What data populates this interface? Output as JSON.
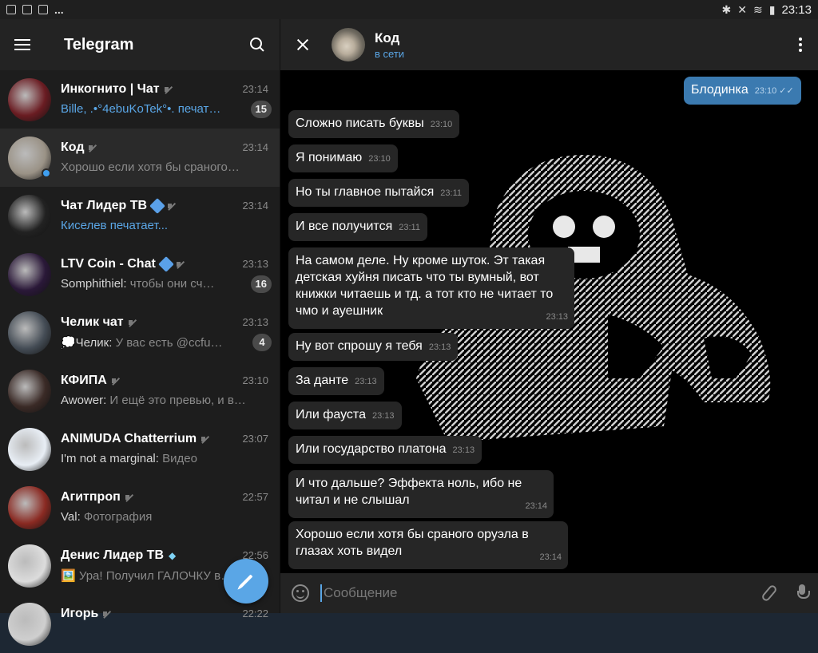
{
  "statusbar": {
    "time": "23:13",
    "dots": "..."
  },
  "sidebar": {
    "app_title": "Telegram",
    "chats": [
      {
        "name": "Инкогнито | Чат",
        "time": "23:14",
        "preview": "Bille, .•°4ebuKoTek°•. печат…",
        "preview_style": "blue",
        "count": "15",
        "avatar_color": "#6a1c22"
      },
      {
        "name": "Код",
        "time": "23:14",
        "preview": "Хорошо если хотя бы сраного…",
        "preview_style": "normal",
        "count": "",
        "avatar_color": "#9a9286"
      },
      {
        "name": "Чат Лидер ТВ",
        "time": "23:14",
        "preview": "Киселев печатает...",
        "preview_style": "blue",
        "count": "",
        "avatar_color": "#222"
      },
      {
        "name": "LTV Coin - Chat",
        "time": "23:13",
        "sender": "Somphithiel:",
        "preview": "чтобы они сч…",
        "preview_style": "normal",
        "count": "16",
        "avatar_color": "#2a1838"
      },
      {
        "name": "Челик чат",
        "time": "23:13",
        "sender": "💭Челик:",
        "preview": "У вас есть @ccfu…",
        "preview_style": "normal",
        "count": "4",
        "avatar_color": "#444c55"
      },
      {
        "name": "КФИПА",
        "time": "23:10",
        "sender": "Awower:",
        "preview": "И ещё это превью, и в…",
        "preview_style": "normal",
        "count": "",
        "avatar_color": "#3a2a26"
      },
      {
        "name": "ANIMUDA Chatterrium",
        "time": "23:07",
        "sender": "I'm not a marginal:",
        "preview": "Видео",
        "preview_style": "normal",
        "count": "",
        "avatar_color": "#e8eef5"
      },
      {
        "name": "Агитпроп",
        "time": "22:57",
        "sender": "Val:",
        "preview": "Фотография",
        "preview_style": "normal",
        "count": "",
        "avatar_color": "#8a2a22"
      },
      {
        "name": "Денис Лидер ТВ",
        "time": "22:56",
        "preview": "🖼️ Ура! Получил ГАЛОЧКУ в…",
        "preview_style": "normal",
        "count": "",
        "avatar_color": "#dcdcdc"
      },
      {
        "name": "Игорь",
        "time": "22:22",
        "preview": "",
        "preview_style": "normal",
        "count": "",
        "avatar_color": "#cfcfcf"
      }
    ]
  },
  "chat": {
    "name": "Код",
    "status": "в сети",
    "messages": [
      {
        "text": "Блодинка",
        "time": "23:10",
        "out": true,
        "ticks": "✓✓"
      },
      {
        "text": "Сложно писать буквы",
        "time": "23:10",
        "out": false
      },
      {
        "text": "Я понимаю",
        "time": "23:10",
        "out": false
      },
      {
        "text": "Но ты главное пытайся",
        "time": "23:11",
        "out": false
      },
      {
        "text": "И все получится",
        "time": "23:11",
        "out": false
      },
      {
        "text": "На самом деле. Ну кроме шуток. Эт такая детская хуйня писать что ты вумный, вот книжки читаешь и тд. а тот кто не читает то чмо и ауешник",
        "time": "23:13",
        "out": false
      },
      {
        "text": "Ну вот спрошу я тебя",
        "time": "23:13",
        "out": false
      },
      {
        "text": "За данте",
        "time": "23:13",
        "out": false
      },
      {
        "text": "Или фауста",
        "time": "23:13",
        "out": false
      },
      {
        "text": "Или государство платона",
        "time": "23:13",
        "out": false
      },
      {
        "text": "И что дальше? Эффекта ноль, ибо не читал и не слышал",
        "time": "23:14",
        "out": false
      },
      {
        "text": "Хорошо если хотя бы сраного оруэла в глазах хоть видел",
        "time": "23:14",
        "out": false
      }
    ],
    "composer_placeholder": "Сообщение"
  },
  "colors": {
    "accent": "#5aa6e6",
    "outgoing_bubble": "#3b7ab0",
    "incoming_bubble": "#262626"
  }
}
